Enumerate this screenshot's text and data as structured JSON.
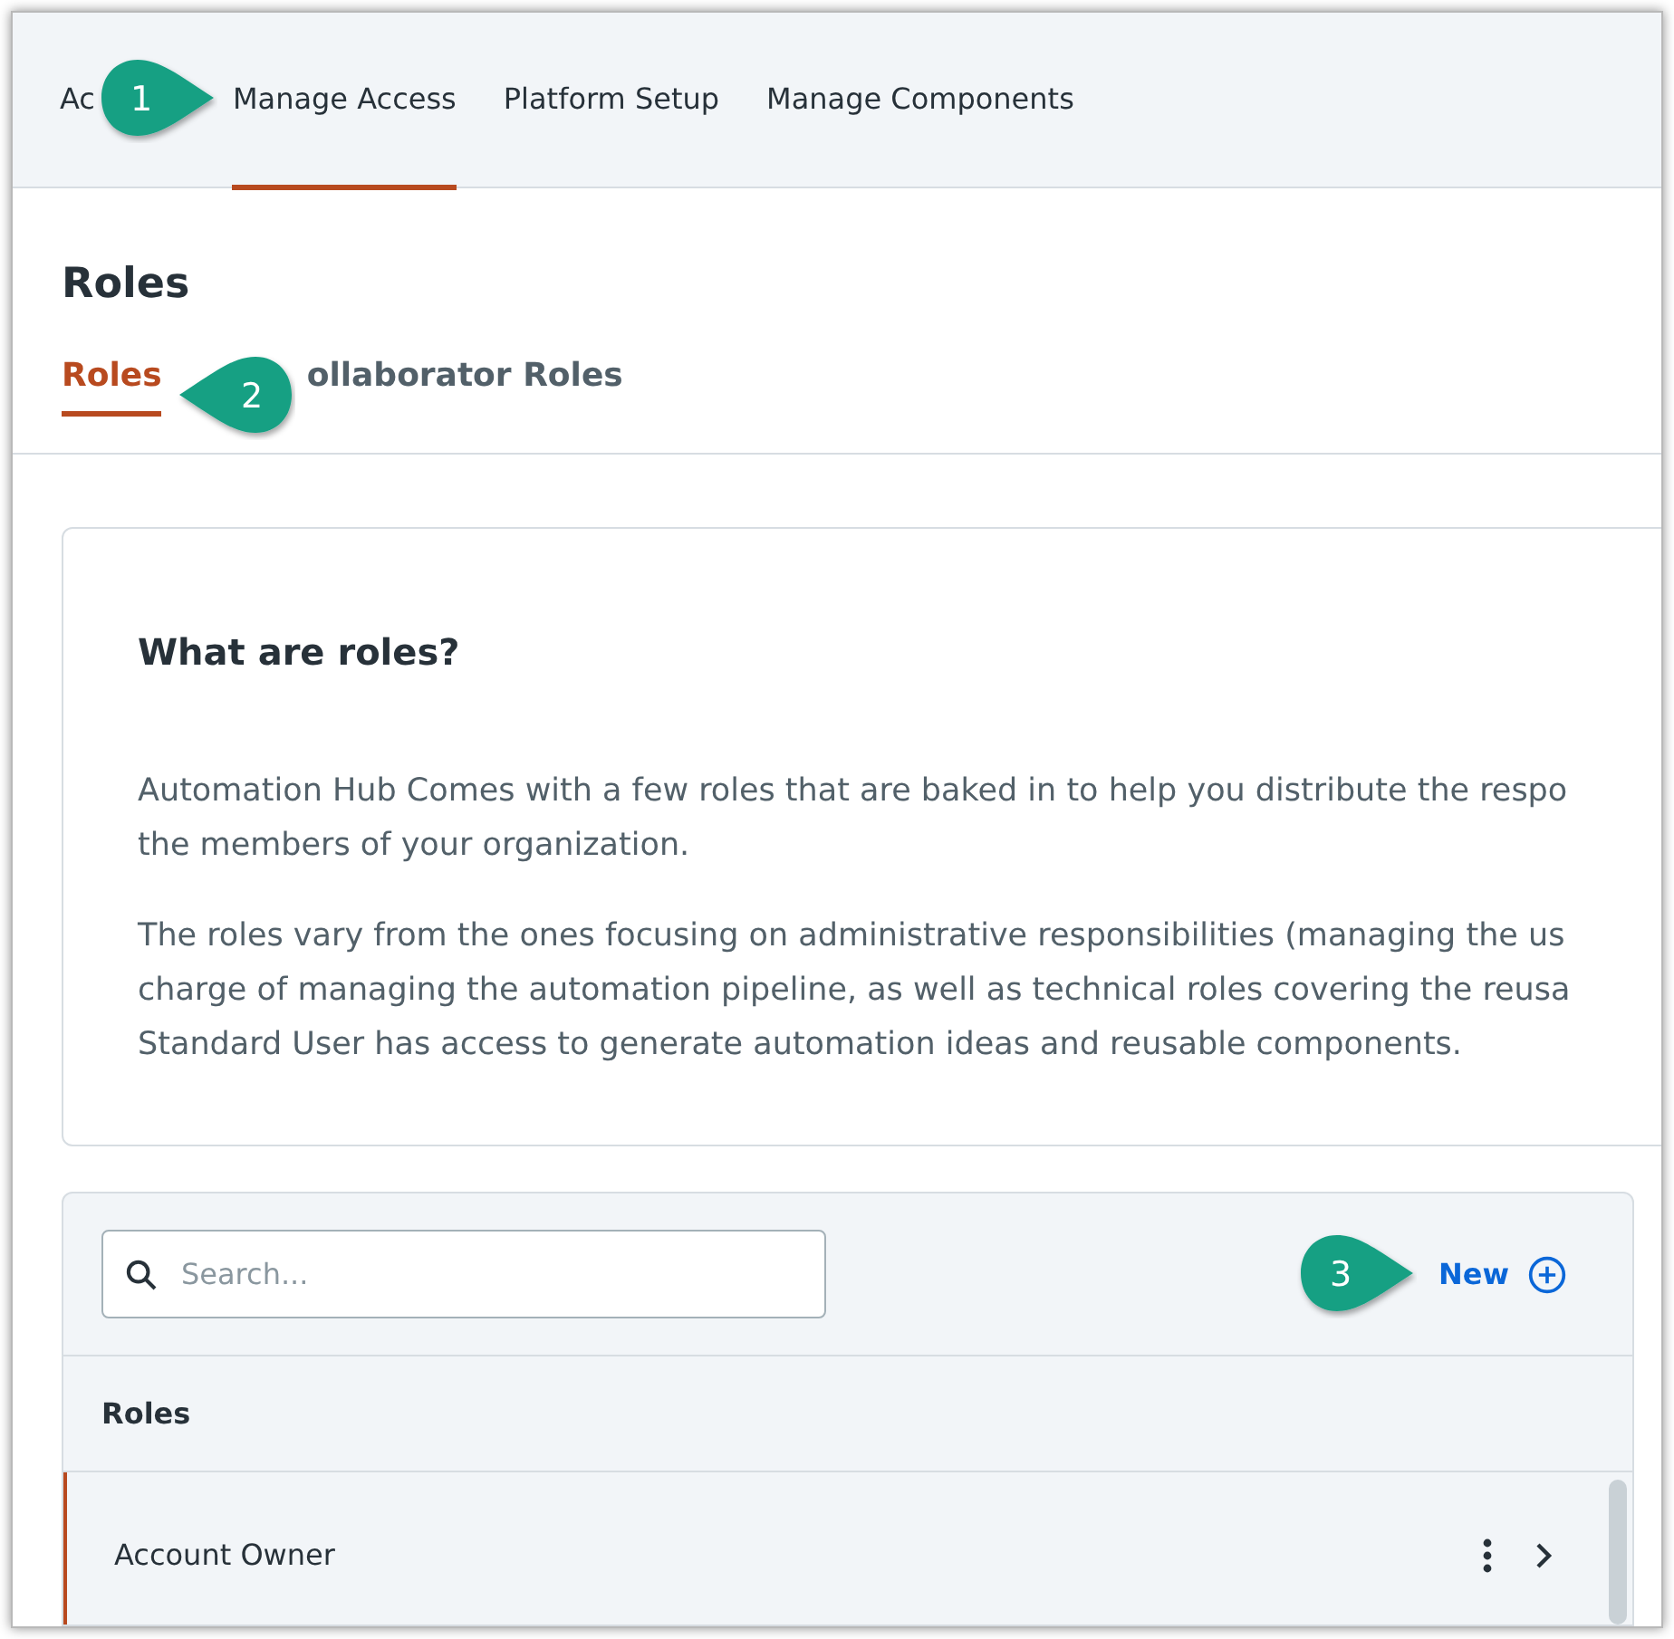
{
  "nav": {
    "tabs": [
      {
        "label": "Ac",
        "selected": false,
        "callout": {
          "number": "1",
          "kind": "right"
        }
      },
      {
        "label": "Manage Access",
        "selected": true
      },
      {
        "label": "Platform Setup",
        "selected": false
      },
      {
        "label": "Manage Components",
        "selected": false
      }
    ]
  },
  "page_title": "Roles",
  "subtabs": [
    {
      "label": "Roles",
      "selected": true
    },
    {
      "label": "ollaborator Roles",
      "selected": false,
      "callout": {
        "number": "2",
        "kind": "left"
      }
    }
  ],
  "info_card": {
    "title": "What are roles?",
    "paragraphs": [
      [
        "Automation Hub Comes with a few roles that are baked in to help you distribute the respo",
        "the members of your organization."
      ],
      [
        "The roles vary from the ones focusing on administrative responsibilities (managing the us",
        "charge of managing the automation pipeline, as well as technical roles covering the reusa",
        "Standard User has access to generate automation ideas and reusable components."
      ]
    ]
  },
  "roles_table": {
    "search": {
      "placeholder": "Search..."
    },
    "callout": {
      "number": "3",
      "kind": "right"
    },
    "new_button": "New",
    "column": "Roles",
    "rows": [
      {
        "name": "Account Owner",
        "selected": true
      }
    ]
  }
}
